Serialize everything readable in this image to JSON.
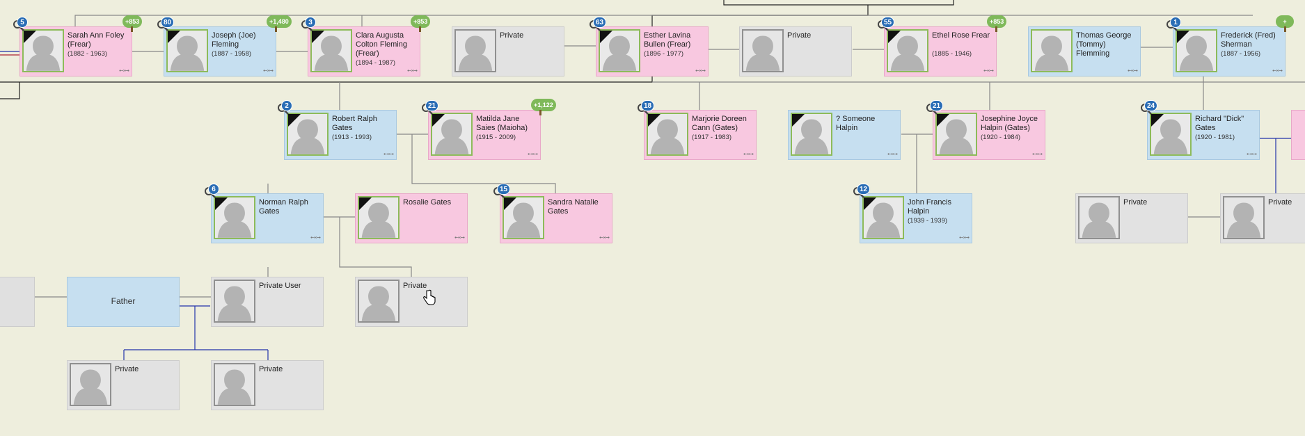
{
  "badge_color": "#2a6db5",
  "tree_color": "#7fb95a",
  "relationship_icon": "relationship-icon",
  "relationship_glyph": "⊷⊶",
  "cards": [
    {
      "id": "sarah",
      "name": "Sarah Ann Foley (Frear)",
      "dates": "(1882 - 1963)",
      "gender": "female",
      "badge": "5",
      "tree": "+853",
      "deceased": true
    },
    {
      "id": "joseph",
      "name": "Joseph (Joe) Fleming",
      "dates": "(1887 - 1958)",
      "gender": "male",
      "badge": "80",
      "tree": "+1,480",
      "deceased": true
    },
    {
      "id": "clara",
      "name": "Clara Augusta Colton Fleming (Frear)",
      "dates": "(1894 - 1987)",
      "gender": "female",
      "badge": "3",
      "tree": "+853",
      "deceased": true
    },
    {
      "id": "private1",
      "name": "Private",
      "dates": "",
      "gender": "private"
    },
    {
      "id": "esther",
      "name": "Esther Lavina Bullen (Frear)",
      "dates": "(1896 - 1977)",
      "gender": "female",
      "badge": "63",
      "deceased": true
    },
    {
      "id": "private2",
      "name": "Private",
      "dates": "",
      "gender": "private"
    },
    {
      "id": "ethel",
      "name": "Ethel Rose Frear",
      "dates": "(1885 - 1946)",
      "gender": "female",
      "badge": "55",
      "tree": "+853",
      "deceased": true
    },
    {
      "id": "thomas",
      "name": "Thomas George (Tommy) Flemming",
      "dates": "",
      "gender": "male"
    },
    {
      "id": "frederick",
      "name": "Frederick (Fred) Sherman",
      "dates": "(1887 - 1956)",
      "gender": "male",
      "badge": "1",
      "tree": "+",
      "deceased": true
    },
    {
      "id": "robert",
      "name": "Robert Ralph Gates",
      "dates": "(1913 - 1993)",
      "gender": "male",
      "badge": "2",
      "deceased": true
    },
    {
      "id": "matilda",
      "name": "Matilda Jane Saies (Maioha)",
      "dates": "(1915 - 2009)",
      "gender": "female",
      "badge": "21",
      "tree": "+1,122",
      "deceased": true
    },
    {
      "id": "marjorie",
      "name": "Marjorie Doreen Cann (Gates)",
      "dates": "(1917 - 1983)",
      "gender": "female",
      "badge": "18",
      "deceased": true
    },
    {
      "id": "someone",
      "name": "? Someone Halpin",
      "dates": "",
      "gender": "male",
      "deceased": true
    },
    {
      "id": "josephine",
      "name": "Josephine Joyce Halpin (Gates)",
      "dates": "(1920 - 1984)",
      "gender": "female",
      "badge": "21",
      "deceased": true
    },
    {
      "id": "richard",
      "name": "Richard \"Dick\" Gates",
      "dates": "(1920 - 1981)",
      "gender": "male",
      "badge": "24",
      "deceased": true
    },
    {
      "id": "norman",
      "name": "Norman Ralph Gates",
      "dates": "",
      "gender": "male",
      "badge": "6",
      "deceased": true
    },
    {
      "id": "rosalie",
      "name": "Rosalie Gates",
      "dates": "",
      "gender": "female",
      "deceased": true
    },
    {
      "id": "sandra",
      "name": "Sandra Natalie Gates",
      "dates": "",
      "gender": "female",
      "badge": "15",
      "deceased": true
    },
    {
      "id": "john",
      "name": "John Francis Halpin",
      "dates": "(1939 - 1939)",
      "gender": "male",
      "badge": "12",
      "deceased": true
    },
    {
      "id": "private3",
      "name": "Private",
      "dates": "",
      "gender": "private"
    },
    {
      "id": "private4",
      "name": "Private",
      "dates": "",
      "gender": "private"
    },
    {
      "id": "privateuser",
      "name": "Private User",
      "dates": "",
      "gender": "private",
      "blueframe": true
    },
    {
      "id": "private5",
      "name": "Private",
      "dates": "",
      "gender": "private"
    },
    {
      "id": "private6",
      "name": "Private",
      "dates": "",
      "gender": "private"
    },
    {
      "id": "private7",
      "name": "Private",
      "dates": "",
      "gender": "private"
    }
  ],
  "simple_cards": [
    {
      "id": "father",
      "label": "Father"
    }
  ]
}
